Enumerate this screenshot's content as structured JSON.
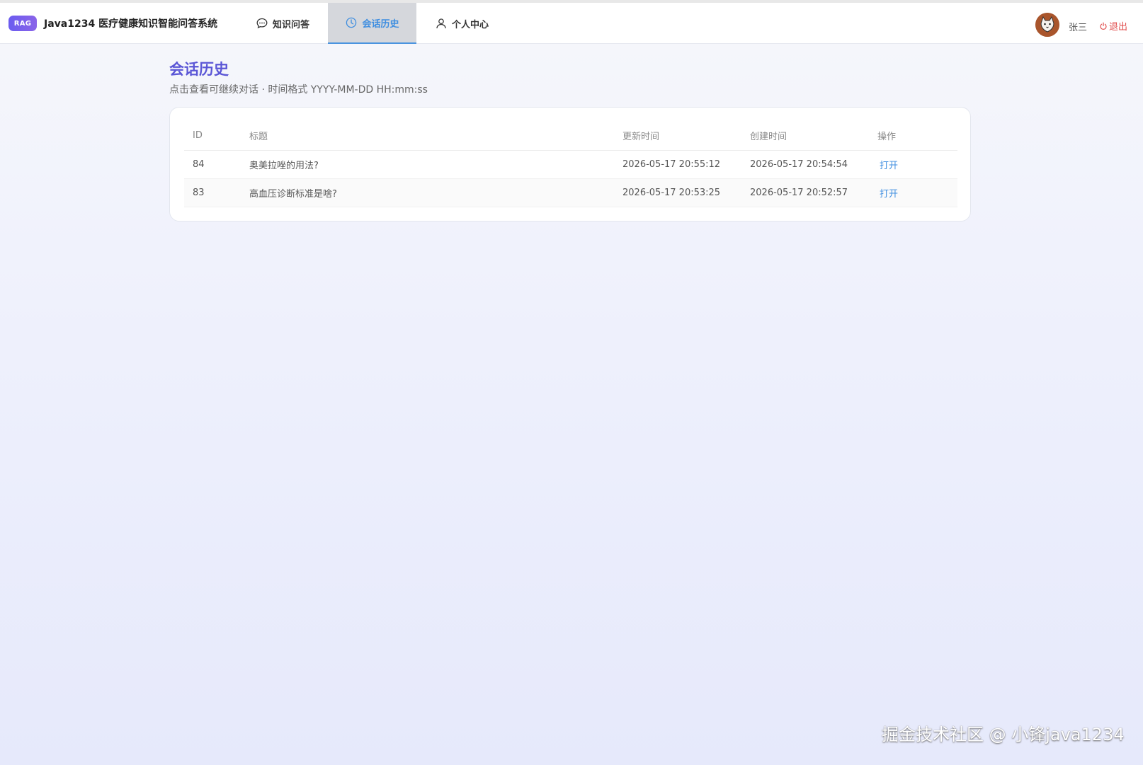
{
  "header": {
    "badge": "RAG",
    "app_title": "Java1234 医疗健康知识智能问答系统",
    "tabs": [
      {
        "label": "知识问答",
        "icon": "chat-bubble-icon",
        "active": false
      },
      {
        "label": "会话历史",
        "icon": "clock-icon",
        "active": true
      },
      {
        "label": "个人中心",
        "icon": "user-icon",
        "active": false
      }
    ],
    "user_name": "张三",
    "logout_label": "退出"
  },
  "main": {
    "title": "会话历史",
    "subtitle": "点击查看可继续对话 · 时间格式 YYYY-MM-DD HH:mm:ss",
    "table": {
      "columns": [
        "ID",
        "标题",
        "更新时间",
        "创建时间",
        "操作"
      ],
      "rows": [
        {
          "id": "84",
          "title": "奥美拉唑的用法?",
          "updated": "2026-05-17 20:55:12",
          "created": "2026-05-17 20:54:54",
          "action": "打开"
        },
        {
          "id": "83",
          "title": "高血压诊断标准是啥?",
          "updated": "2026-05-17 20:53:25",
          "created": "2026-05-17 20:52:57",
          "action": "打开"
        }
      ]
    }
  },
  "watermark": "掘金技术社区 @ 小锋java1234",
  "colors": {
    "accent": "#5b57d6",
    "link": "#3f8ee0",
    "logout": "#e04a4a",
    "badge": "#6b5cf0"
  }
}
